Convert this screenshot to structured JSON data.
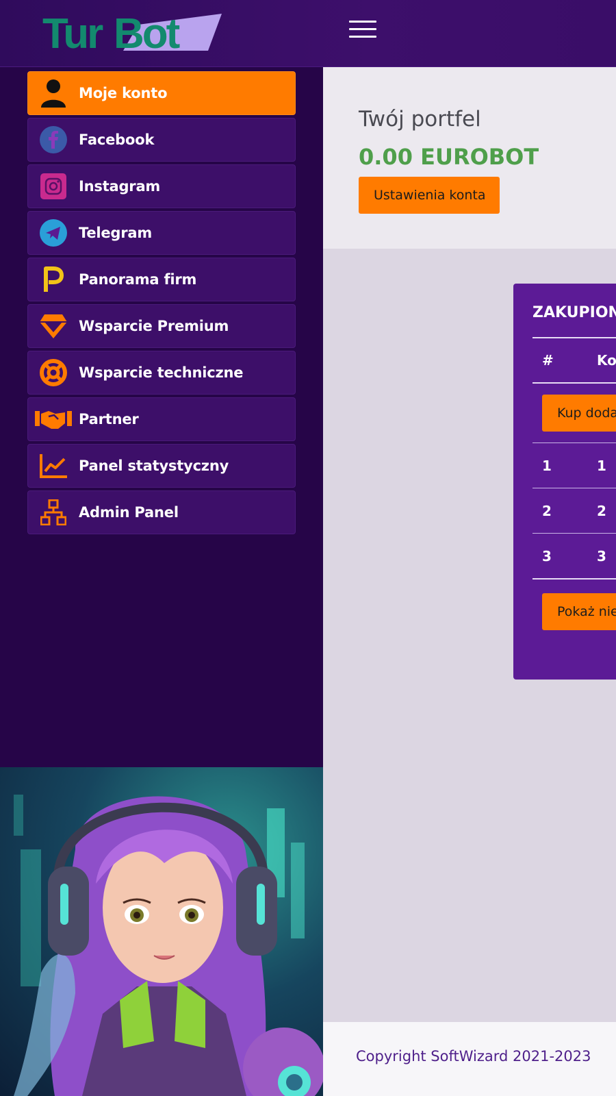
{
  "header": {
    "logo_text_a": "Tur",
    "logo_text_b": "Bot",
    "menu_toggle_icon": "hamburger-icon"
  },
  "sidebar": {
    "items": [
      {
        "label": "Moje konto",
        "icon": "user-icon",
        "active": true
      },
      {
        "label": "Facebook",
        "icon": "facebook-icon"
      },
      {
        "label": "Instagram",
        "icon": "instagram-icon"
      },
      {
        "label": "Telegram",
        "icon": "telegram-icon"
      },
      {
        "label": "Panorama firm",
        "icon": "panorama-p-icon"
      },
      {
        "label": "Wsparcie Premium",
        "icon": "diamond-icon"
      },
      {
        "label": "Wsparcie techniczne",
        "icon": "lifebuoy-icon"
      },
      {
        "label": "Partner",
        "icon": "handshake-icon"
      },
      {
        "label": "Panel statystyczny",
        "icon": "chart-line-icon"
      },
      {
        "label": "Admin Panel",
        "icon": "sitemap-icon"
      }
    ]
  },
  "wallet": {
    "title": "Twój portfel",
    "amount": "0.00 EUROBOT",
    "settings_button": "Ustawienia konta"
  },
  "purchased": {
    "title": "ZAKUPIONE",
    "headers": [
      "#",
      "Ko"
    ],
    "buy_button": "Kup dodatkowe",
    "rows": [
      [
        "1",
        "1"
      ],
      [
        "2",
        "2"
      ],
      [
        "3",
        "3"
      ]
    ],
    "show_more_button": "Pokaż nieaktywne"
  },
  "footer": {
    "copyright": "Copyright SoftWizard 2021-2023"
  },
  "colors": {
    "accent": "#ff7b00",
    "sidebar_bg": "#260548",
    "menu_item_bg": "#3d0f69",
    "card_bg": "#5c1b96",
    "amount_green": "#4f9f4b"
  }
}
